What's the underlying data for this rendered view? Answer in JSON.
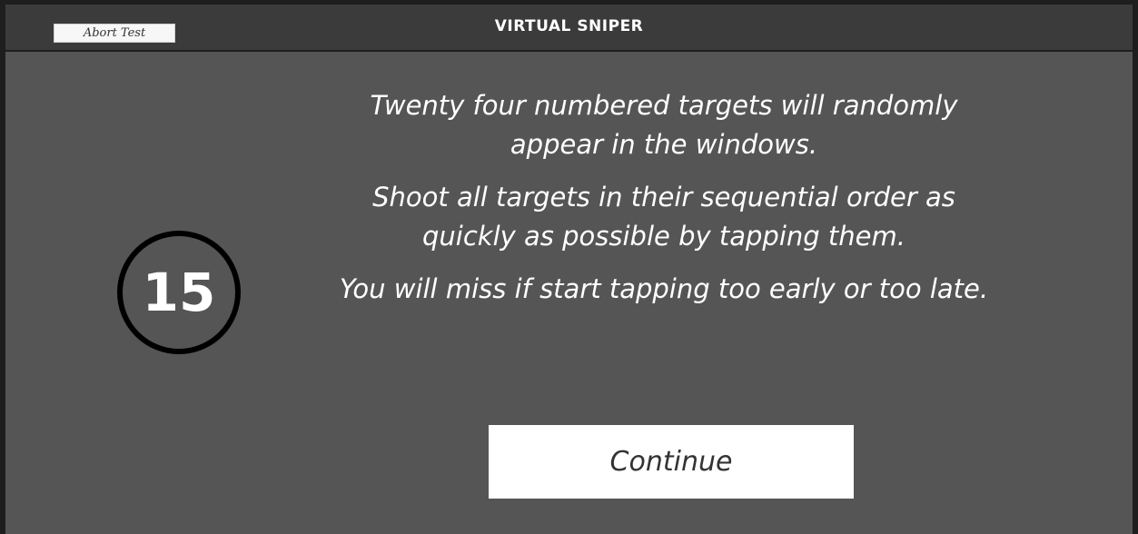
{
  "header": {
    "abort_label": "Abort Test",
    "title": "VIRTUAL SNIPER"
  },
  "target": {
    "number": "15"
  },
  "instructions": {
    "paragraph1": "Twenty four numbered targets will randomly appear in the windows.",
    "paragraph2": "Shoot all targets in their sequential order as quickly as possible by tapping them.",
    "paragraph3": "You will miss if start tapping too early or too late."
  },
  "actions": {
    "continue_label": "Continue"
  },
  "colors": {
    "background": "#555555",
    "titlebar": "#3b3b3b",
    "text": "#ffffff",
    "button": "#ffffff",
    "button_text": "#333333",
    "target_ring": "#000000"
  }
}
